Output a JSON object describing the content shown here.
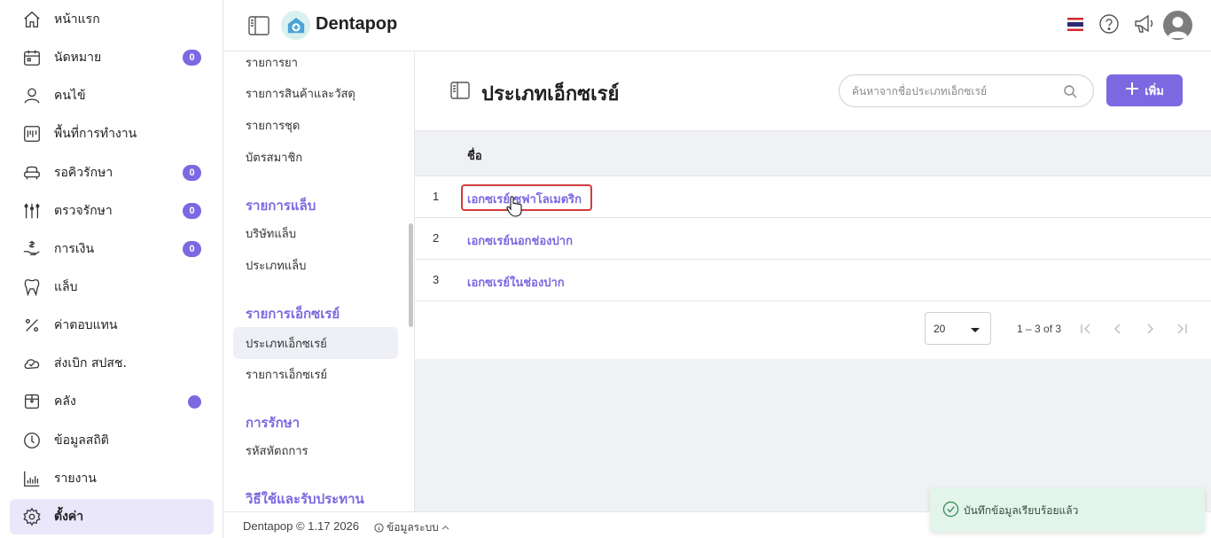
{
  "header": {
    "brand": "Dentapop",
    "language": "Thai"
  },
  "nav": {
    "items": [
      {
        "label": "หน้าแรก",
        "icon": "home-icon"
      },
      {
        "label": "นัดหมาย",
        "icon": "calendar-icon",
        "badge": "0"
      },
      {
        "label": "คนไข้",
        "icon": "user-icon"
      },
      {
        "label": "พื้นที่การทำงาน",
        "icon": "workspace-icon"
      },
      {
        "label": "รอคิวรักษา",
        "icon": "dental-chair-icon",
        "badge": "0"
      },
      {
        "label": "ตรวจรักษา",
        "icon": "dental-tools-icon",
        "badge": "0"
      },
      {
        "label": "การเงิน",
        "icon": "money-hand-icon",
        "badge": "0"
      },
      {
        "label": "แล็บ",
        "icon": "tooth-icon"
      },
      {
        "label": "ค่าตอบแทน",
        "icon": "percent-icon"
      },
      {
        "label": "ส่งเบิก สปสช.",
        "icon": "cloud-check-icon"
      },
      {
        "label": "คลัง",
        "icon": "box-icon"
      },
      {
        "label": "ข้อมูลสถิติ",
        "icon": "stats-gauge-icon"
      },
      {
        "label": "รายงาน",
        "icon": "bar-chart-icon"
      },
      {
        "label": "ตั้งค่า",
        "icon": "gear-icon",
        "active": true
      }
    ]
  },
  "submenu": {
    "items": [
      {
        "label": "รายการยา"
      },
      {
        "label": "รายการสินค้าและวัสดุ"
      },
      {
        "label": "รายการชุด"
      },
      {
        "label": "บัตรสมาชิก"
      },
      {
        "label": "บริษัทแล็บ"
      },
      {
        "label": "ประเภทแล็บ"
      },
      {
        "label": "ประเภทเอ็กซเรย์"
      },
      {
        "label": "รายการเอ็กซเรย์"
      },
      {
        "label": "รหัสหัตถการ"
      }
    ],
    "headings": [
      "รายการแล็บ",
      "รายการเอ็กซเรย์",
      "การรักษา",
      "วิธีใช้และรับประทาน"
    ]
  },
  "page": {
    "title": "ประเภทเอ็กซเรย์",
    "search_placeholder": "ค้นหาจากชื่อประเภทเอ็กซเรย์",
    "add_label": "เพิ่ม",
    "column_name": "ชื่อ",
    "rows": [
      {
        "index": "1",
        "name": "เอกซเรย์เซฟาโลเมตริก"
      },
      {
        "index": "2",
        "name": "เอกซเรย์นอกช่องปาก"
      },
      {
        "index": "3",
        "name": "เอกซเรย์ในช่องปาก"
      }
    ],
    "page_size": "20",
    "range_text": "1 – 3 of 3"
  },
  "footer": {
    "copyright": "Dentapop © 1.17 2026",
    "system_info": "ข้อมูลระบบ"
  },
  "toast": {
    "message": "บันทึกข้อมูลเรียบร้อยแล้ว"
  },
  "colors": {
    "accent": "#7c68e0",
    "active_bg": "#ebe7fb",
    "toast_bg": "#e3f4ea",
    "highlight_border": "#d33b3b"
  }
}
